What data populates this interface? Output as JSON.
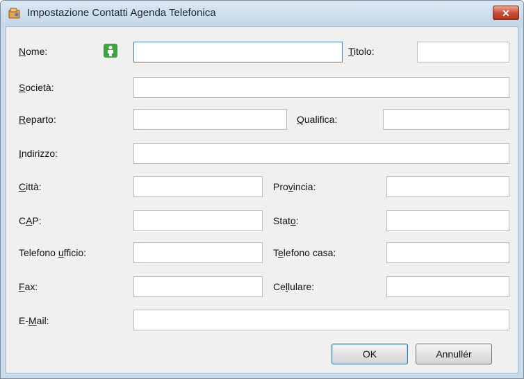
{
  "window": {
    "title": "Impostazione Contatti Agenda Telefonica",
    "close_label": "x"
  },
  "labels": {
    "nome": [
      "",
      "N",
      "ome:"
    ],
    "titolo": [
      "",
      "T",
      "itolo:"
    ],
    "societa": [
      "",
      "S",
      "ocietà:"
    ],
    "reparto": [
      "",
      "R",
      "eparto:"
    ],
    "qualifica": [
      "",
      "Q",
      "ualifica:"
    ],
    "indirizzo": [
      "",
      "I",
      "ndirizzo:"
    ],
    "citta": [
      "",
      "C",
      "ittà:"
    ],
    "provincia": [
      "Pro",
      "v",
      "incia:"
    ],
    "cap": [
      "C",
      "A",
      "P:"
    ],
    "stato": [
      "Stat",
      "o",
      ":"
    ],
    "telefono_ufficio": [
      "Telefono ",
      "u",
      "fficio:"
    ],
    "telefono_casa": [
      "T",
      "e",
      "lefono casa:"
    ],
    "fax": [
      "",
      "F",
      "ax:"
    ],
    "cellulare": [
      "Ce",
      "l",
      "lulare:"
    ],
    "email": [
      "E-",
      "M",
      "ail:"
    ]
  },
  "fields": {
    "nome": "",
    "titolo": "",
    "societa": "",
    "reparto": "",
    "qualifica": "",
    "indirizzo": "",
    "citta": "",
    "provincia": "",
    "cap": "",
    "stato": "",
    "telefono_ufficio": "",
    "telefono_casa": "",
    "fax": "",
    "cellulare": "",
    "email": ""
  },
  "buttons": {
    "ok": "OK",
    "cancel": "Annullér"
  },
  "icons": {
    "app": "phonebook-icon",
    "contact": "person-icon",
    "close": "close-icon"
  },
  "colors": {
    "title_bar": "#c4d6e8",
    "close_button": "#c84a32",
    "contact_icon": "#3ea341",
    "focus_border": "#3c7fb1"
  }
}
